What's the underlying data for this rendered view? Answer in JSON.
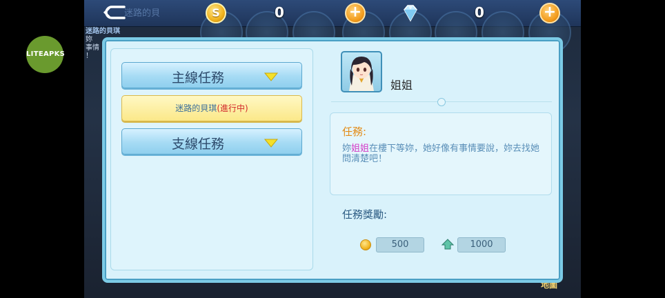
{
  "hud": {
    "bg_title": "迷路的貝",
    "coins": "0",
    "gems": "0",
    "coin_symbol": "S",
    "plus_label": "+"
  },
  "background": {
    "side_label_1": "迷路的貝琪",
    "side_label_2": "妳",
    "side_label_3": "事情",
    "side_label_4": "！",
    "map_label": "地圖"
  },
  "watermark": {
    "text": "LITEAPKS"
  },
  "quest_list": {
    "main_category": "主線任務",
    "side_category": "支線任務",
    "active_quest": {
      "name": "迷路的貝琪",
      "status": "(進行中)"
    }
  },
  "quest_detail": {
    "npc_name": "姐姐",
    "task_heading": "任務:",
    "description_pre": "妳",
    "description_highlight": "姐姐",
    "description_post": "在樓下等妳，她好像有事情要說，妳去找她問清楚吧！",
    "reward_heading": "任務獎勵:",
    "reward_coins": "500",
    "reward_exp": "1000"
  },
  "colors": {
    "accent_orange": "#e38b16",
    "highlight_pink": "#d23ac6",
    "status_red": "#d2262a",
    "dialog_border": "#7ccbe6"
  }
}
